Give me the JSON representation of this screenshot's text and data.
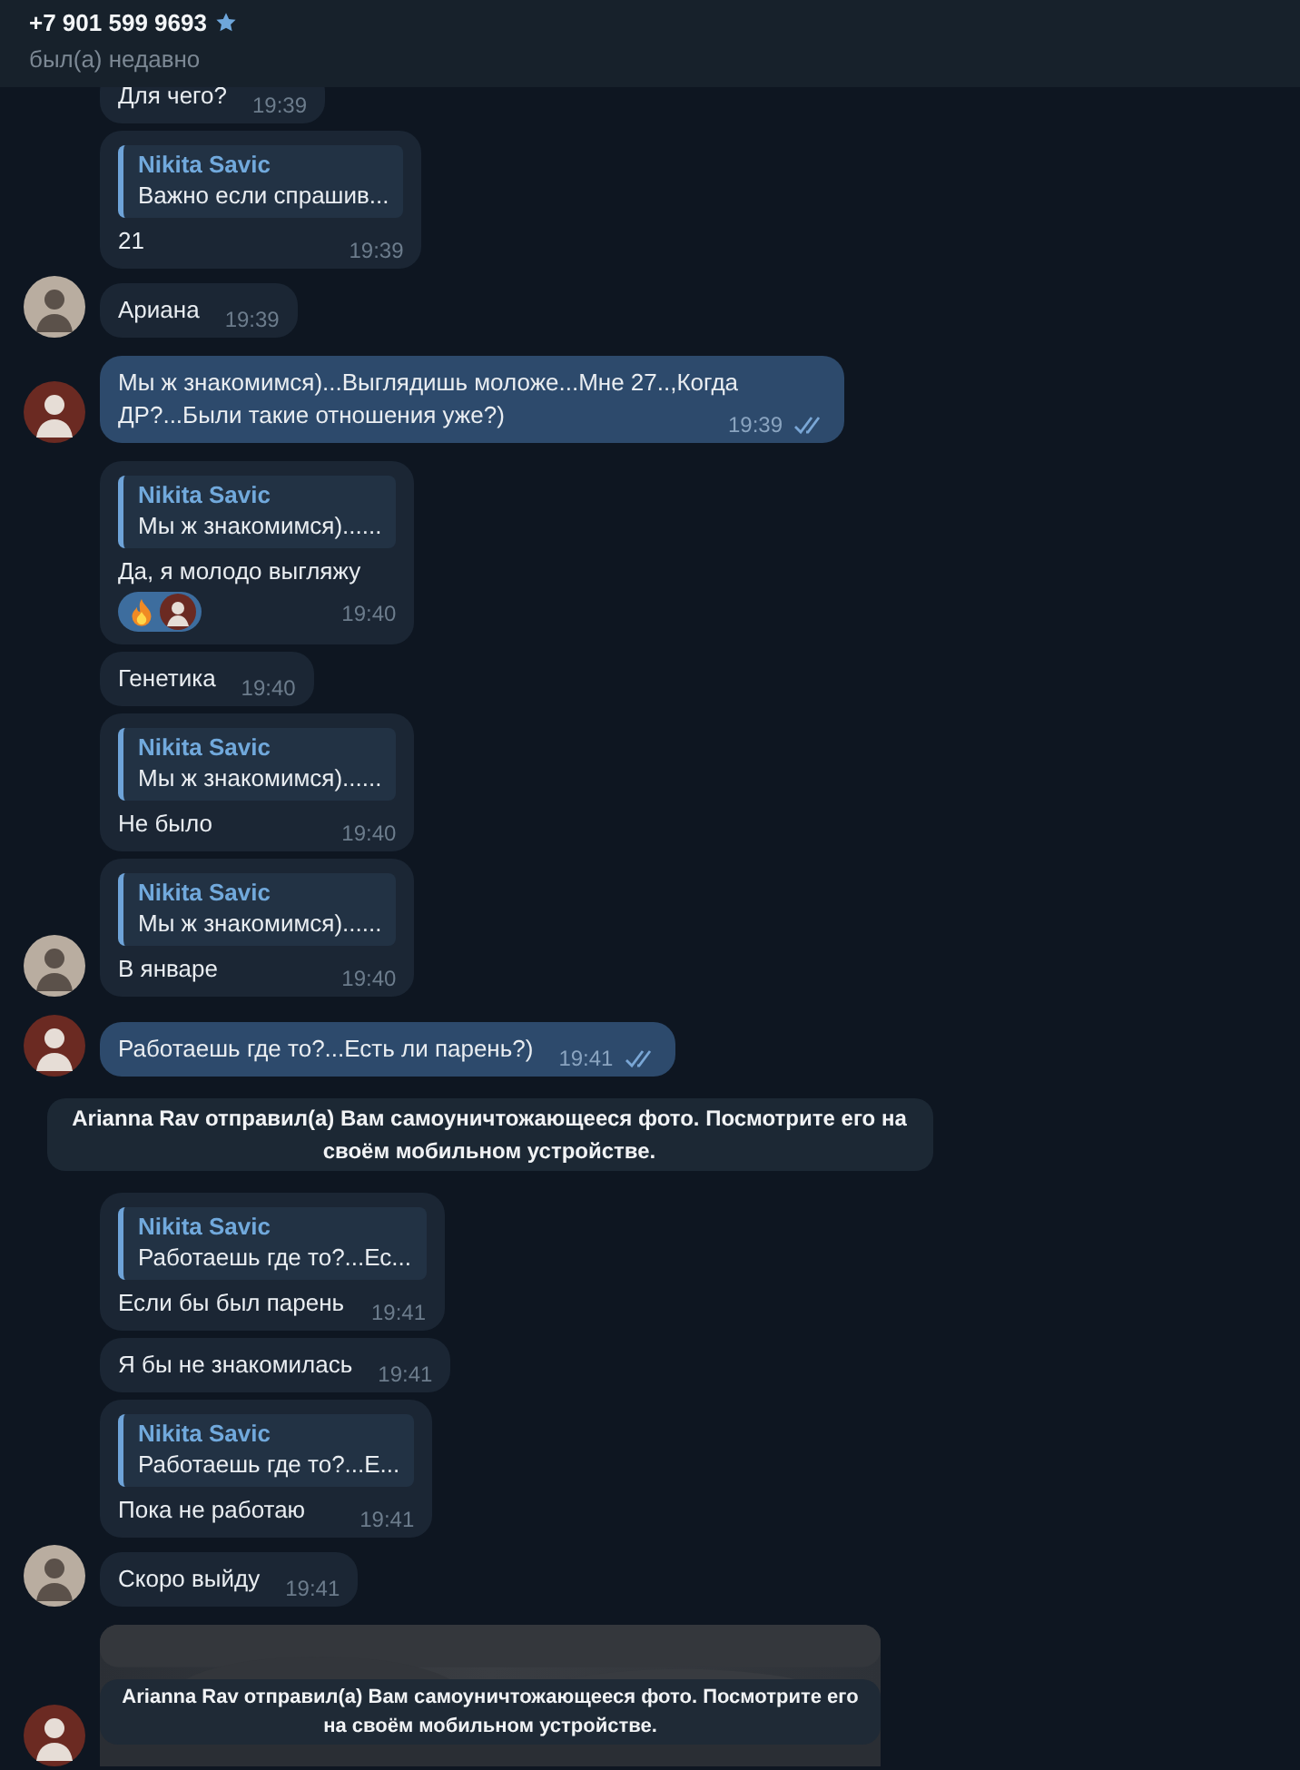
{
  "header": {
    "title": "+7 901 599 9693",
    "starred": true,
    "status": "был(а) недавно"
  },
  "messages": [
    {
      "kind": "incoming",
      "text": "Для чего?",
      "time": "19:39"
    },
    {
      "kind": "incoming",
      "reply": {
        "author": "Nikita Savic",
        "text": "Важно если спрашив..."
      },
      "text": "21",
      "time": "19:39"
    },
    {
      "kind": "incoming",
      "text": "Ариана",
      "time": "19:39",
      "avatar": {
        "kind": "contact"
      }
    },
    {
      "kind": "outgoing",
      "text": "Мы ж знакомимся)...Выглядишь моложе...Мне 27..,Когда ДР?...Были такие отношения уже?)",
      "time": "19:39",
      "read": true,
      "avatar": {
        "kind": "me"
      }
    },
    {
      "kind": "incoming",
      "reply": {
        "author": "Nikita Savic",
        "text": "Мы ж знакомимся)......"
      },
      "text": "Да, я молодо выгляжу",
      "reaction": {
        "kind": "fire"
      },
      "time": "19:40"
    },
    {
      "kind": "incoming",
      "text": "Генетика",
      "time": "19:40"
    },
    {
      "kind": "incoming",
      "reply": {
        "author": "Nikita Savic",
        "text": "Мы ж знакомимся)......"
      },
      "text": "Не было",
      "time": "19:40"
    },
    {
      "kind": "incoming",
      "reply": {
        "author": "Nikita Savic",
        "text": "Мы ж знакомимся)......"
      },
      "text": "В январе",
      "time": "19:40",
      "avatar": {
        "kind": "contact"
      }
    },
    {
      "kind": "outgoing",
      "text": "Работаешь где то?...Есть ли парень?)",
      "time": "19:41",
      "read": true,
      "avatar": {
        "kind": "me"
      }
    },
    {
      "kind": "service",
      "text": "Arianna Rav отправил(а) Вам самоуничтожающееся фото. Посмотрите его на своём мобильном устройстве."
    },
    {
      "kind": "incoming",
      "reply": {
        "author": "Nikita Savic",
        "text": "Работаешь где то?...Ес..."
      },
      "text": "Если бы был парень",
      "time": "19:41"
    },
    {
      "kind": "incoming",
      "text": "Я бы не знакомилась",
      "time": "19:41"
    },
    {
      "kind": "incoming",
      "reply": {
        "author": "Nikita Savic",
        "text": "Работаешь где то?...Е..."
      },
      "text": "Пока не работаю",
      "time": "19:41"
    },
    {
      "kind": "incoming",
      "text": "Скоро выйду",
      "time": "19:41",
      "avatar": {
        "kind": "contact"
      }
    },
    {
      "caption": "Arianna Rav отправил(а) Вам самоуничтожающееся фото. Посмотрите его на своём мобильном устройстве.",
      "avatar": {
        "kind": "me"
      }
    }
  ]
}
